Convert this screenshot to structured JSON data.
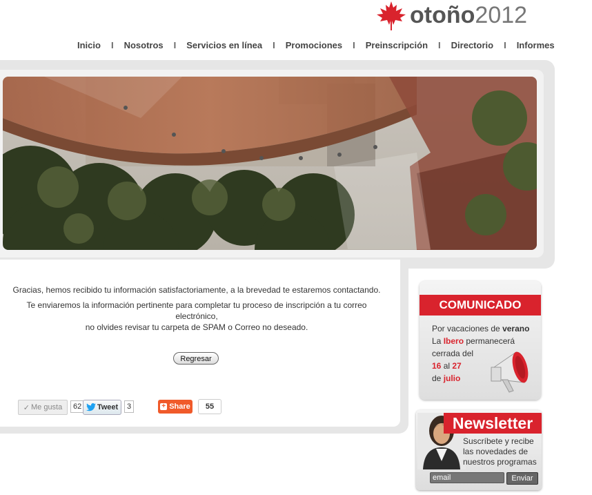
{
  "brand": {
    "wordmark_main": "otoño",
    "wordmark_year": "2012",
    "accent_color": "#d9232d"
  },
  "nav": {
    "items": [
      "Inicio",
      "Nosotros",
      "Servicios en línea",
      "Promociones",
      "Preinscripción",
      "Directorio",
      "Informes"
    ],
    "separator": "I"
  },
  "hero": {
    "icon": "campus-architecture-photo"
  },
  "main": {
    "line1": "Gracias, hemos recibido tu información satisfactoriamente, a la brevedad te estaremos contactando.",
    "line2": "Te enviaremos la información pertinente para completar tu proceso de inscripción a tu correo electrónico,",
    "line3": "no olvides revisar tu carpeta de SPAM o Correo no deseado.",
    "back_button": "Regresar"
  },
  "social": {
    "like_label": "Me gusta",
    "like_count": "62",
    "tweet_label": "Tweet",
    "tweet_count": "3",
    "share_label": "Share",
    "share_count": "55"
  },
  "comunicado": {
    "title": "COMUNICADO",
    "l1a": "Por vacaciones de ",
    "l1b": "verano",
    "l2a": "La ",
    "l2b": "Ibero",
    "l2c": " permanecerá",
    "l3": "cerrada del",
    "l4a": "16",
    "l4b": " al ",
    "l4c": "27",
    "l5a": "de ",
    "l5b": "julio",
    "icon": "megaphone-icon"
  },
  "newsletter": {
    "title": "Newsletter",
    "text1": "Suscríbete y recibe",
    "text2": "las novedades de",
    "text3": "nuestros programas",
    "email_placeholder": "email",
    "send_label": "Enviar"
  }
}
